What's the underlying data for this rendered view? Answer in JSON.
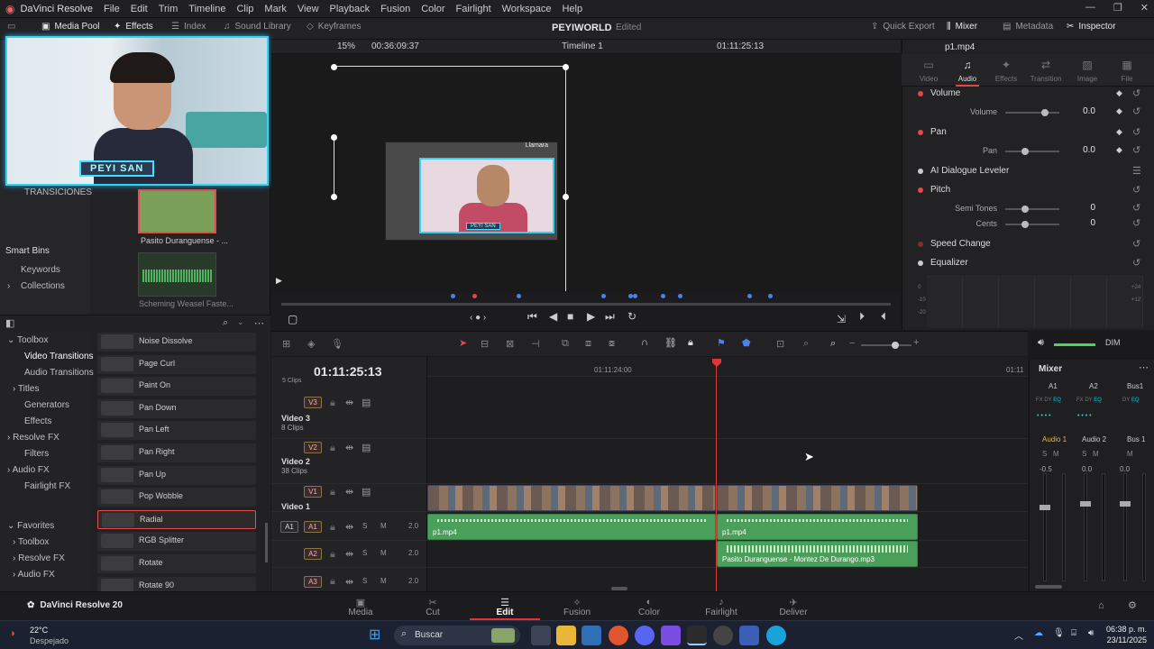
{
  "app": {
    "title": "DaVinci Resolve",
    "version_label": "DaVinci Resolve 20"
  },
  "menu": [
    "File",
    "Edit",
    "Trim",
    "Timeline",
    "Clip",
    "Mark",
    "View",
    "Playback",
    "Fusion",
    "Color",
    "Fairlight",
    "Workspace",
    "Help"
  ],
  "toolbar": {
    "media_pool": "Media Pool",
    "effects": "Effects",
    "index": "Index",
    "sound_library": "Sound Library",
    "keyframes": "Keyframes",
    "project": "PEYIWORLD",
    "project_state": "Edited",
    "quick_export": "Quick Export",
    "mixer": "Mixer",
    "metadata": "Metadata",
    "inspector": "Inspector"
  },
  "left": {
    "transitions_label": "TRANSICIONES",
    "webcam_tag": "PEYI SAN",
    "smart_bins": "Smart Bins",
    "keywords": "Keywords",
    "collections": "Collections",
    "thumb1": "Pasito Duranguense - ...",
    "thumb2": "Scheming Weasel Faste..."
  },
  "viewer": {
    "zoom": "15%",
    "duration": "00:36:09:37",
    "timeline_name": "Timeline 1",
    "timecode": "01:11:25:13",
    "frame_text": "Llamara",
    "frame_tag": "PEYI SAN"
  },
  "inspector": {
    "clip_name": "p1.mp4",
    "tabs": [
      "Video",
      "Audio",
      "Effects",
      "Transition",
      "Image",
      "File"
    ],
    "volume": {
      "title": "Volume",
      "label": "Volume",
      "value": "0.0"
    },
    "pan": {
      "title": "Pan",
      "label": "Pan",
      "value": "0.0"
    },
    "ai_dialogue": "AI Dialogue Leveler",
    "pitch": {
      "title": "Pitch",
      "semitones_label": "Semi Tones",
      "semitones": "0",
      "cents_label": "Cents",
      "cents": "0"
    },
    "speed_change": "Speed Change",
    "equalizer": "Equalizer",
    "eq_left_scale": [
      "0",
      "-10",
      "-20"
    ],
    "eq_right_scale": [
      "+24",
      "+12"
    ]
  },
  "effects": {
    "tree": {
      "toolbox": "Toolbox",
      "video_transitions": "Video Transitions",
      "audio_transitions": "Audio Transitions",
      "titles": "Titles",
      "generators": "Generators",
      "effects": "Effects",
      "resolve_fx": "Resolve FX",
      "filters": "Filters",
      "audio_fx": "Audio FX",
      "fairlight_fx": "Fairlight FX",
      "favorites": "Favorites",
      "fav_toolbox": "Toolbox",
      "fav_resolve_fx": "Resolve FX",
      "fav_audio_fx": "Audio FX"
    },
    "items": [
      "Noise Dissolve",
      "Page Curl",
      "Paint On",
      "Pan Down",
      "Pan Left",
      "Pan Right",
      "Pan Up",
      "Pop Wobble",
      "Radial",
      "RGB Splitter",
      "Rotate",
      "Rotate 90"
    ],
    "selected": "Radial"
  },
  "timeline": {
    "timecode": "01:11:25:13",
    "ruler_label": "01:11:24:00",
    "ruler_label2": "01:11",
    "partial_label": "5 Clips",
    "tracks": {
      "v3": "V3",
      "v2": "V2",
      "v1": "V1",
      "a1": "A1",
      "a2": "A2",
      "a3": "A3",
      "video3": "Video 3",
      "video3_clips": "8 Clips",
      "video2": "Video 2",
      "video2_clips": "38 Clips",
      "video1": "Video 1",
      "a1_vol": "2.0",
      "a2_vol": "2.0",
      "a3_vol": "2.0",
      "s": "S",
      "m": "M"
    },
    "clips": {
      "a1_left": "p1.mp4",
      "a1_right": "p1.mp4",
      "a2": "Pasito Duranguense - Montez De Durango.mp3"
    }
  },
  "mixer": {
    "title": "Mixer",
    "dim": "DIM",
    "cols": [
      "A1",
      "A2",
      "Bus1"
    ],
    "names": [
      "Audio 1",
      "Audio 2",
      "Bus 1"
    ],
    "levels": [
      "-0.5",
      "0.0",
      "0.0"
    ],
    "fx": "FX",
    "dy": "DY",
    "eq": "EQ"
  },
  "pages": [
    "Media",
    "Cut",
    "Edit",
    "Fusion",
    "Color",
    "Fairlight",
    "Deliver"
  ],
  "active_page": "Edit",
  "taskbar": {
    "temp": "22°C",
    "weather": "Despejado",
    "search": "Buscar",
    "time": "06:38 p. m.",
    "date": "23/11/2025"
  },
  "colors": {
    "accent": "#e03535",
    "cyan": "#37d2ee",
    "audio_clip": "#4a9f5a"
  }
}
